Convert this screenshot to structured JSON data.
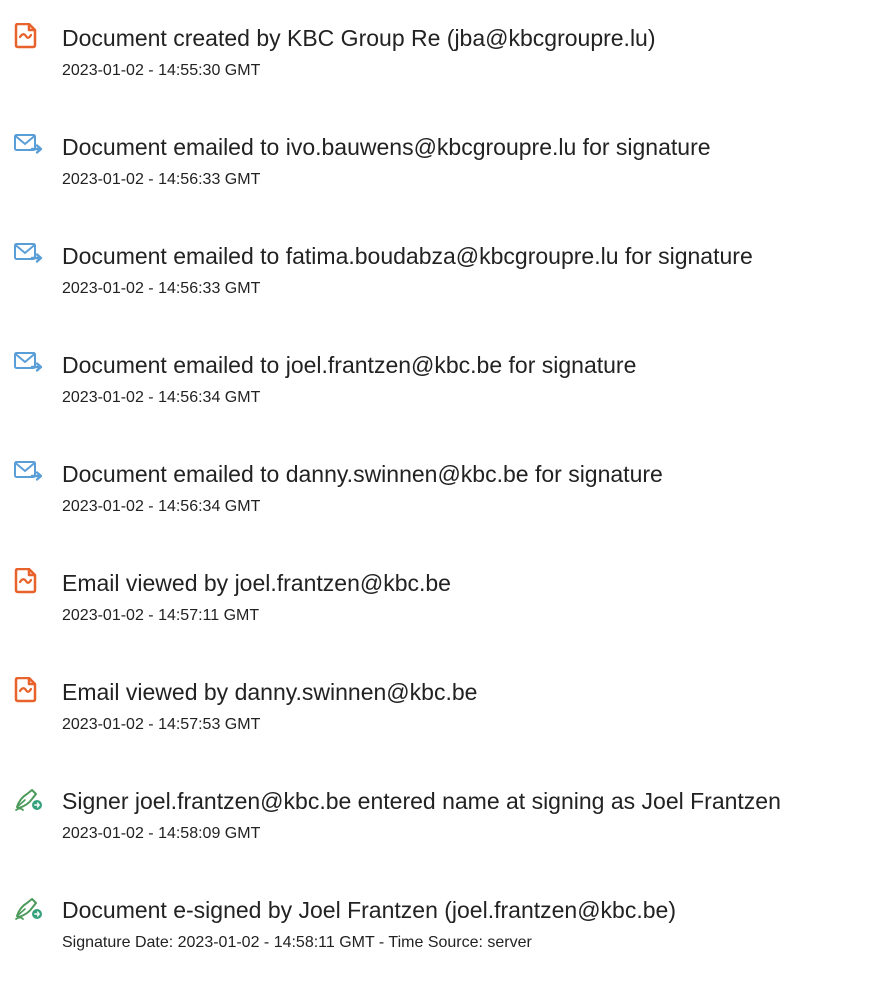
{
  "events": [
    {
      "icon": "document-icon",
      "title": "Document created by KBC Group Re (jba@kbcgroupre.lu)",
      "time": "2023-01-02 - 14:55:30 GMT"
    },
    {
      "icon": "email-icon",
      "title": "Document emailed to ivo.bauwens@kbcgroupre.lu for signature",
      "time": "2023-01-02 - 14:56:33 GMT"
    },
    {
      "icon": "email-icon",
      "title": "Document emailed to fatima.boudabza@kbcgroupre.lu for signature",
      "time": "2023-01-02 - 14:56:33 GMT"
    },
    {
      "icon": "email-icon",
      "title": "Document emailed to joel.frantzen@kbc.be for signature",
      "time": "2023-01-02 - 14:56:34 GMT"
    },
    {
      "icon": "email-icon",
      "title": "Document emailed to danny.swinnen@kbc.be for signature",
      "time": "2023-01-02 - 14:56:34 GMT"
    },
    {
      "icon": "document-icon",
      "title": "Email viewed by joel.frantzen@kbc.be",
      "time": "2023-01-02 - 14:57:11 GMT"
    },
    {
      "icon": "document-icon",
      "title": "Email viewed by danny.swinnen@kbc.be",
      "time": "2023-01-02 - 14:57:53 GMT"
    },
    {
      "icon": "signature-pen-icon",
      "title": "Signer joel.frantzen@kbc.be entered name at signing as Joel Frantzen",
      "time": "2023-01-02 - 14:58:09 GMT"
    },
    {
      "icon": "signature-pen-icon",
      "title": "Document e-signed by Joel Frantzen (joel.frantzen@kbc.be)",
      "time": "Signature Date: 2023-01-02 - 14:58:11 GMT - Time Source: server"
    }
  ],
  "colors": {
    "document_icon": "#e8632b",
    "email_icon": "#5a9ed8",
    "pen_icon": "#4c9a5a",
    "text": "#222222"
  }
}
